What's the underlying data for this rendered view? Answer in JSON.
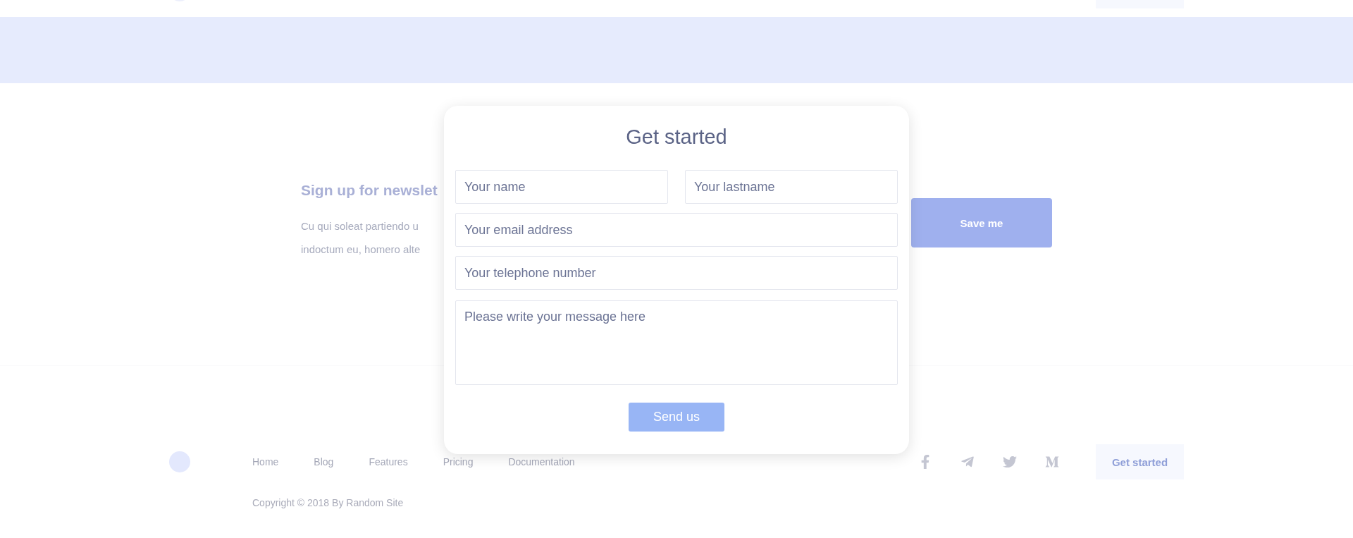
{
  "newsletter": {
    "heading": "Sign up for newslet",
    "lines": [
      "Cu qui soleat partiendo u",
      "indoctum eu, homero alte"
    ],
    "button": "Save me"
  },
  "modal": {
    "title": "Get started",
    "fields": [
      {
        "kind": "input",
        "placeholder": "Your name"
      },
      {
        "kind": "input",
        "placeholder": "Your lastname"
      },
      {
        "kind": "input",
        "placeholder": "Your email address"
      },
      {
        "kind": "input",
        "placeholder": "Your telephone number"
      },
      {
        "kind": "textarea",
        "placeholder": "Please write your message here"
      }
    ],
    "button": "Send us"
  },
  "footer": {
    "nav": [
      "Home",
      "Blog",
      "Features",
      "Pricing",
      "Documentation"
    ],
    "social": [
      {
        "kind": "facebook"
      },
      {
        "kind": "telegram"
      },
      {
        "kind": "twitter"
      },
      {
        "kind": "medium"
      }
    ],
    "button": "Get started",
    "copyright": "Copyright © 2018 By Random Site"
  }
}
